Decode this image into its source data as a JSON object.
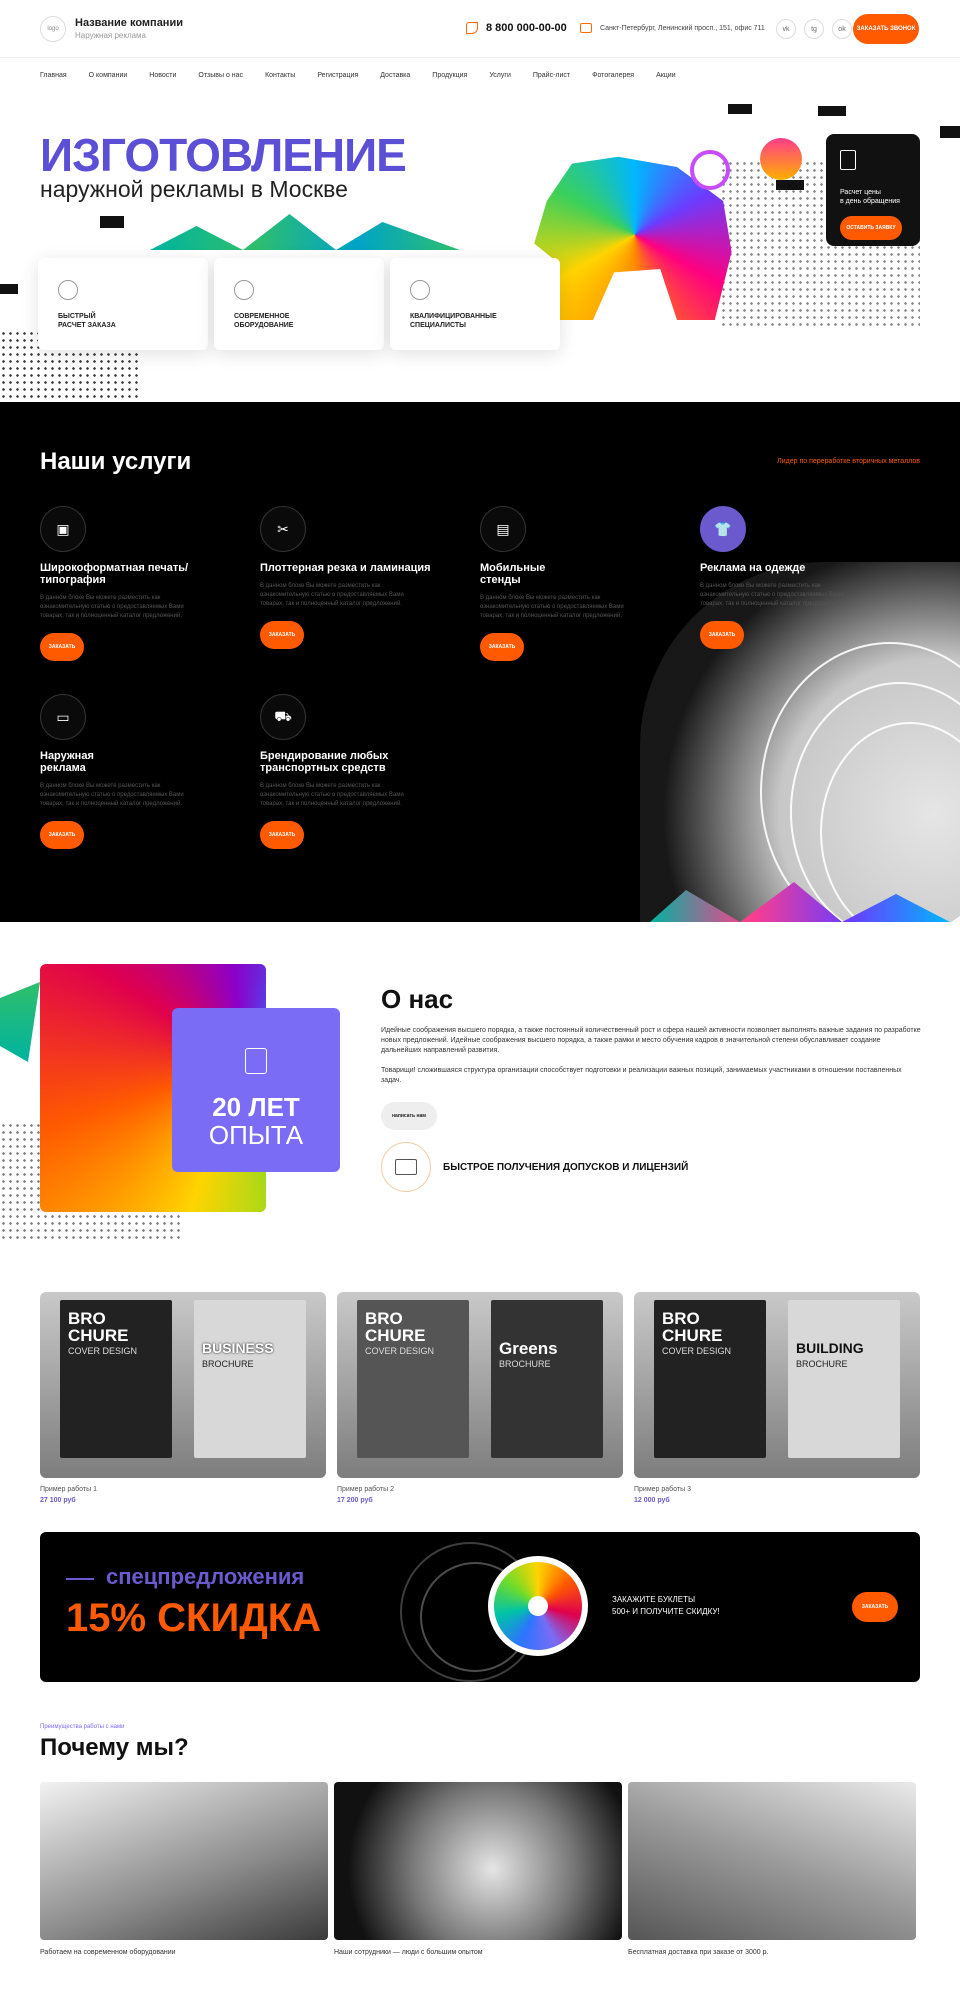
{
  "header": {
    "logo_text": "logo",
    "company_name": "Название компании",
    "company_sub": "Наружная реклама",
    "phone": "8 800 000-00-00",
    "address": "Санкт-Петербург, Ленинский просп., 151, офис 711",
    "socials": [
      "vk",
      "tg",
      "ok"
    ],
    "call_button": "заказать звонок"
  },
  "nav": {
    "items": [
      "Главная",
      "О компании",
      "Новости",
      "Отзывы о нас",
      "Контакты",
      "Регистрация",
      "Доставка",
      "Продукция",
      "Услуги",
      "Прайс-лист",
      "Фотогалерея",
      "Акции"
    ]
  },
  "hero": {
    "title": "ИЗГОТОВЛЕНИЕ",
    "subtitle": "наружной рекламы в Москве",
    "features": [
      {
        "label_line1": "Быстрый",
        "label_line2": "расчет заказа",
        "icon": "clock-icon"
      },
      {
        "label_line1": "Современное",
        "label_line2": "оборудование",
        "icon": "gear-icon"
      },
      {
        "label_line1": "Квалифицированные",
        "label_line2": "специалисты",
        "icon": "helmet-icon"
      }
    ],
    "promo": {
      "line1": "Расчет цены",
      "line2": "в день обращения",
      "button": "оставить заявку",
      "icon": "clipboard-icon"
    }
  },
  "services": {
    "title": "Наши услуги",
    "leader_link": "Лидер по переработке вторичных металлов",
    "items": [
      {
        "name_line1": "Широкоформатная печать/",
        "name_line2": "типография",
        "icon": "print-icon",
        "button": "заказать"
      },
      {
        "name_line1": "Плоттерная резка и ламинация",
        "name_line2": "",
        "icon": "cut-icon",
        "button": "заказать"
      },
      {
        "name_line1": "Мобильные",
        "name_line2": "стенды",
        "icon": "stand-icon",
        "button": "заказать"
      },
      {
        "name_line1": "Реклама на одежде",
        "name_line2": "",
        "icon": "tshirt-icon",
        "button": "заказать"
      },
      {
        "name_line1": "Наружная",
        "name_line2": "реклама",
        "icon": "billboard-icon",
        "button": "заказать"
      },
      {
        "name_line1": "Брендирование любых",
        "name_line2": "транспортных средств",
        "icon": "truck-icon",
        "button": "заказать"
      }
    ],
    "desc_line1": "В данном блоке Вы можете разместить как",
    "desc_line2": "ознакомительную статью о предоставляемых Вами",
    "desc_line3": "товарах, так и полноценный каталог предложений."
  },
  "about": {
    "badge_number": "20 ЛЕТ",
    "badge_word": "ОПЫТА",
    "heading": "О нас",
    "paragraph1": "Идейные соображения высшего порядка, а также постоянный количественный рост и сфера нашей активности позволяет выполнять важные задания по разработке новых предложений. Идейные соображения высшего порядка, а также рамки и место обучения кадров в значительной степени обуславливает создание дальнейших направлений развития.",
    "paragraph2": "Товарищи! сложившаяся структура организации способствует подготовки и реализации важных позиций, занимаемых участниками в отношении поставленных задач.",
    "button": "написать нам",
    "license": "Быстрое получения допусков и лицензий"
  },
  "portfolio": {
    "items": [
      {
        "name": "Пример работы 1",
        "price": "27 100 руб",
        "left_big1": "BRO",
        "left_big2": "CHURE",
        "left_small": "COVER DESIGN",
        "right_big": "BUSINESS",
        "right_small": "BROCHURE"
      },
      {
        "name": "Пример работы 2",
        "price": "17 200 руб",
        "left_big1": "BRO",
        "left_big2": "CHURE",
        "left_small": "COVER DESIGN",
        "right_big": "Greens",
        "right_small": "BROCHURE"
      },
      {
        "name": "Пример работы 3",
        "price": "12 000 руб",
        "left_big1": "BRO",
        "left_big2": "CHURE",
        "left_small": "COVER DESIGN",
        "right_big": "BUILDING",
        "right_small": "BROCHURE"
      }
    ]
  },
  "offer": {
    "kicker": "спецпредложения",
    "big": "15% СКИДКА",
    "text_line1": "Закажите буклеты",
    "text_line2": "500+ и получите скидку!",
    "button": "заказать"
  },
  "why": {
    "kicker": "Преимущества работы с нами",
    "title": "Почему мы?",
    "items": [
      {
        "caption": "Работаем на современном оборудовании"
      },
      {
        "caption": "Наши сотрудники — люди с большим опытом"
      },
      {
        "caption": "Бесплатная доставка при заказе от 3000 р."
      }
    ]
  },
  "colors": {
    "accent": "#ff5a00",
    "brand": "#6a5acd",
    "dark": "#000000"
  }
}
